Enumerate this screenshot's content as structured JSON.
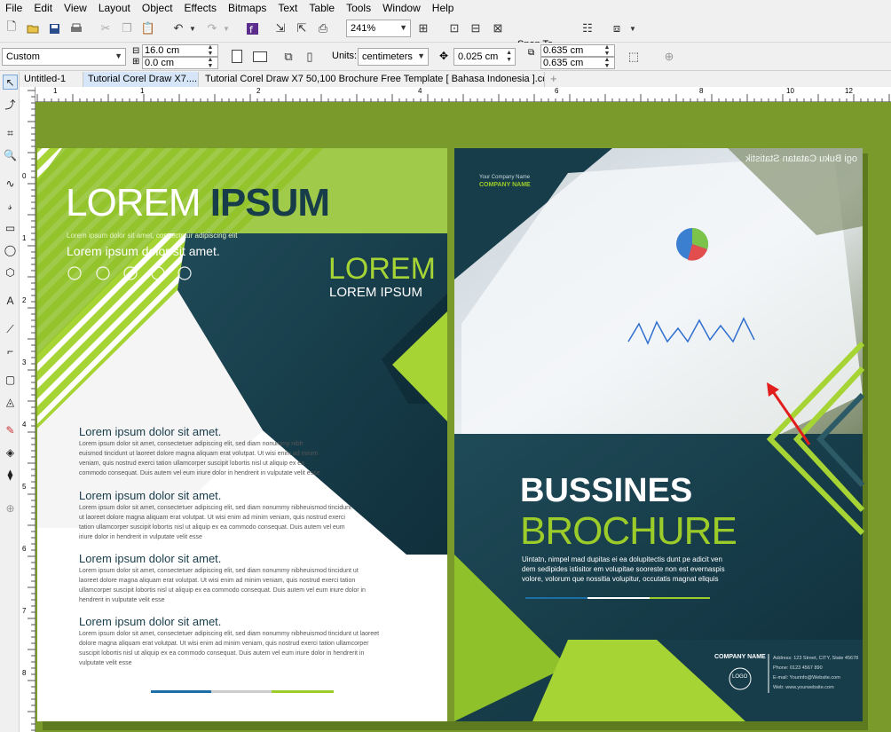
{
  "menu": [
    "File",
    "Edit",
    "View",
    "Layout",
    "Object",
    "Effects",
    "Bitmaps",
    "Text",
    "Table",
    "Tools",
    "Window",
    "Help"
  ],
  "toolbar": {
    "zoom": "241%",
    "snap_label": "Snap To"
  },
  "propbar": {
    "preset": "Custom",
    "width": "16.0 cm",
    "height": "0.0 cm",
    "units_label": "Units:",
    "units": "centimeters",
    "nudge": "0.025 cm",
    "dup_x": "0.635 cm",
    "dup_y": "0.635 cm"
  },
  "tabs": [
    "Untitled-1",
    "Tutorial Corel Draw X7....",
    "Tutorial Corel Draw X7 50,100 Brochure Free Template [ Bahasa Indonesia ].cdr"
  ],
  "ruler": {
    "h_ticks": [
      "1",
      "1",
      "2",
      "4",
      "6",
      "8",
      "10",
      "12"
    ],
    "v_ticks": [
      "0",
      "1",
      "2",
      "3",
      "4",
      "5",
      "6",
      "7",
      "8"
    ]
  },
  "brochure": {
    "left": {
      "title_white": "LOREM ",
      "title_dark": "IPSUM",
      "subtitle_small": "Lorem ipsum dolor sit amet, consectetur adipiscing elit",
      "subtitle": "Lorem ipsum dolor sit amet.",
      "mid_title": "LOREM",
      "mid_sub": "LOREM IPSUM",
      "sections": [
        {
          "heading": "Lorem ipsum dolor sit amet.",
          "lines": [
            "Lorem ipsum dolor sit amet, consectetuer adipiscing elit, sed diam nonummy nibh",
            "euismod tincidunt ut laoreet dolore magna aliquam erat volutpat. Ut wisi enim ad minim",
            "veniam, quis nostrud exerci tation ullamcorper suscipit lobortis nisl ut aliquip ex ea",
            "commodo consequat. Duis autem vel eum iriure dolor in hendrerit in vulputate velit esse"
          ]
        },
        {
          "heading": "Lorem ipsum dolor sit amet.",
          "lines": [
            "Lorem ipsum dolor sit amet, consectetuer adipiscing elit, sed diam nonummy nibheuismod tincidunt",
            "ut laoreet dolore magna aliquam erat volutpat. Ut wisi enim ad minim veniam, quis nostrud exerci",
            "tation ullamcorper suscipit lobortis nisl ut aliquip ex ea commodo consequat. Duis autem vel eum",
            "iriure dolor in hendrerit in vulputate velit esse"
          ]
        },
        {
          "heading": "Lorem ipsum dolor sit amet.",
          "lines": [
            "Lorem ipsum dolor sit amet, consectetuer adipiscing elit, sed diam nonummy nibheuismod tincidunt ut",
            "laoreet dolore magna aliquam erat volutpat. Ut wisi enim ad minim veniam, quis nostrud exerci tation",
            "ullamcorper suscipit lobortis nisl ut aliquip ex ea commodo consequat. Duis autem vel eum iriure dolor in",
            "hendrerit in vulputate velit esse"
          ]
        },
        {
          "heading": "Lorem ipsum dolor sit amet.",
          "lines": [
            "Lorem ipsum dolor sit amet, consectetuer adipiscing elit, sed diam nonummy nibheuismod tincidunt ut laoreet",
            "dolore magna aliquam erat volutpat. Ut wisi enim ad minim veniam, quis nostrud exerci tation ullamcorper",
            "suscipit lobortis nisl ut aliquip ex ea commodo consequat. Duis autem vel eum iriure dolor in hendrerit in",
            "vulputate velit esse"
          ]
        }
      ]
    },
    "right": {
      "company_small": "Your Company Name",
      "company": "COMPANY NAME",
      "watermark": "ogi  Buku Catatan  Statistik",
      "title1": "BUSSINES",
      "title2": "BROCHURE",
      "desc": [
        "Uintatn, nimpel mad dupitas ei ea dolupitectis dunt pe adicit ven",
        "dem sedipides istisitor em volupitae sooreste non est evernaspis",
        "volore, volorum que nossitia volupitur, occutatis magnat eliquis"
      ],
      "footer_company": "COMPANY NAME",
      "logo": "LOGO",
      "contact": [
        "Address: 123 Street, CITY, State 45678",
        "Phone: 0123 4567 890",
        "E-mail: Yourinfo@Website.com",
        "Web: www.yourwebsite.com"
      ]
    }
  },
  "colors": {
    "accent": "#9ccc2a",
    "dark": "#173c4a",
    "canvas": "#7a9a2c"
  }
}
